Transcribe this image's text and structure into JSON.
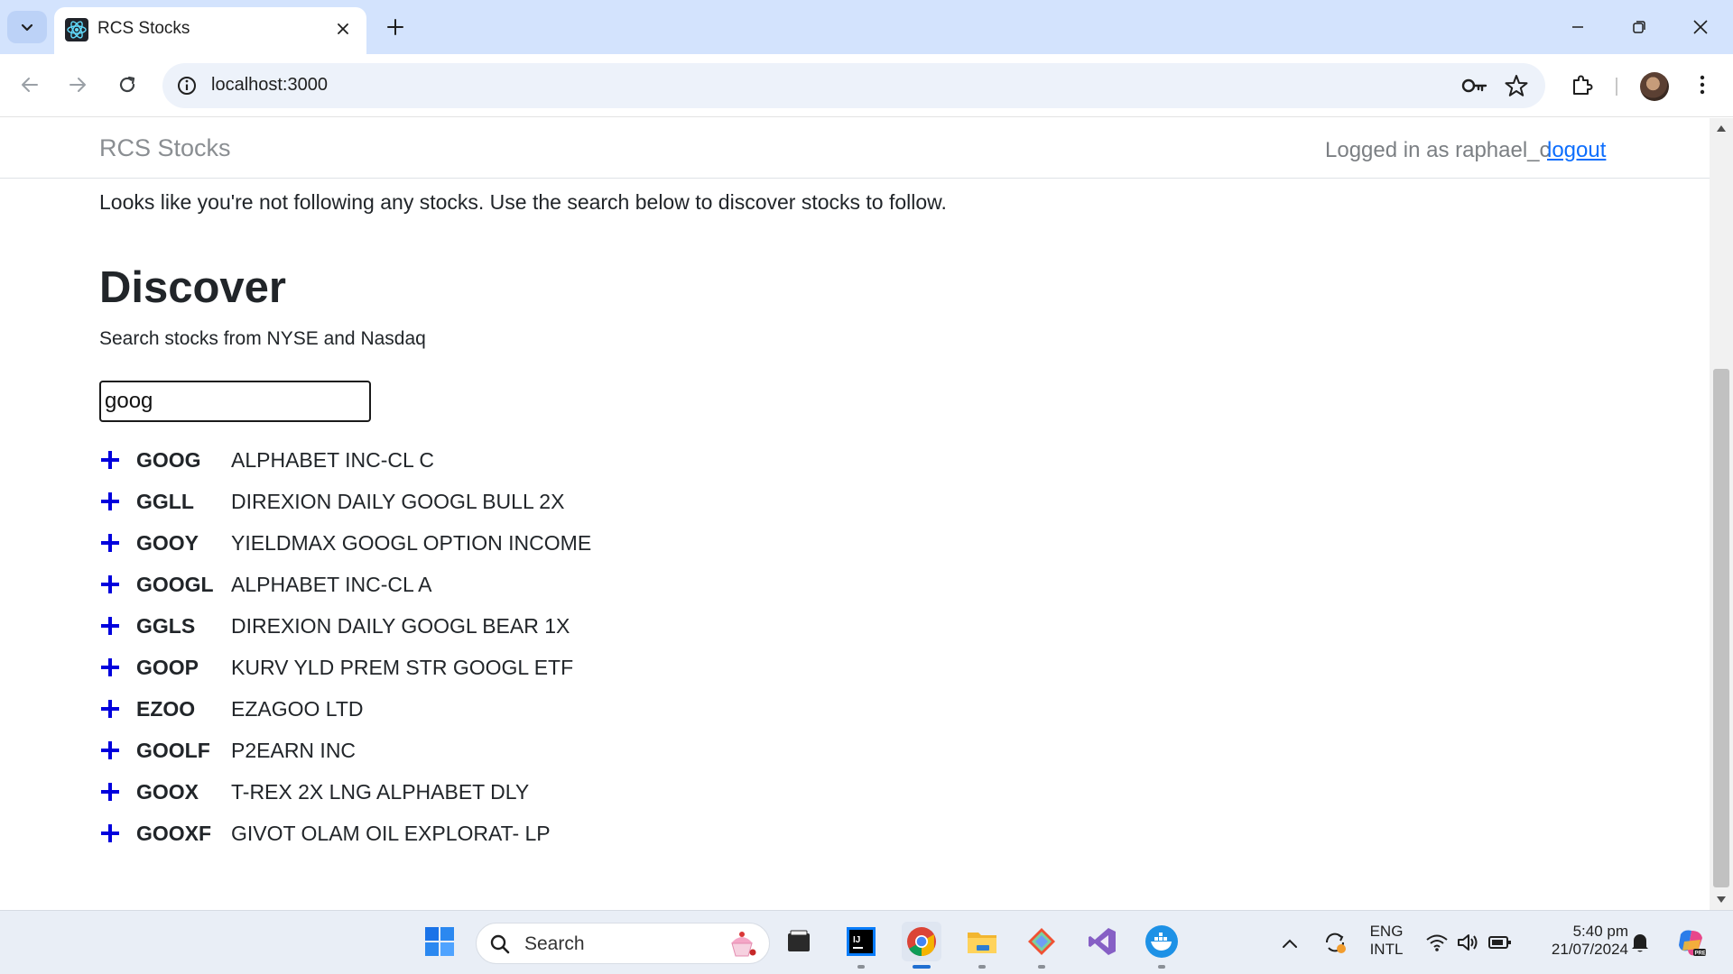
{
  "browser": {
    "tab_title": "RCS Stocks",
    "url": "localhost:3000"
  },
  "app": {
    "brand": "RCS Stocks",
    "logged_in_text": "Logged in as raphael_c",
    "logout_label": "logout",
    "notice": "Looks like you're not following any stocks. Use the search below to discover stocks to follow.",
    "discover_title": "Discover",
    "discover_subtitle": "Search stocks from NYSE and Nasdaq",
    "search_value": "goog",
    "results": [
      {
        "symbol": "GOOG",
        "name": "ALPHABET INC-CL C"
      },
      {
        "symbol": "GGLL",
        "name": "DIREXION DAILY GOOGL BULL 2X"
      },
      {
        "symbol": "GOOY",
        "name": "YIELDMAX GOOGL OPTION INCOME"
      },
      {
        "symbol": "GOOGL",
        "name": "ALPHABET INC-CL A"
      },
      {
        "symbol": "GGLS",
        "name": "DIREXION DAILY GOOGL BEAR 1X"
      },
      {
        "symbol": "GOOP",
        "name": "KURV YLD PREM STR GOOGL ETF"
      },
      {
        "symbol": "EZOO",
        "name": "EZAGOO LTD"
      },
      {
        "symbol": "GOOLF",
        "name": "P2EARN INC"
      },
      {
        "symbol": "GOOX",
        "name": "T-REX 2X LNG ALPHABET DLY"
      },
      {
        "symbol": "GOOXF",
        "name": "GIVOT OLAM OIL EXPLORAT- LP"
      }
    ],
    "accent_color": "#0000dd",
    "link_color": "#0d6efd"
  },
  "taskbar": {
    "search_label": "Search",
    "lang_top": "ENG",
    "lang_bottom": "INTL",
    "time": "5:40 pm",
    "date": "21/07/2024"
  }
}
